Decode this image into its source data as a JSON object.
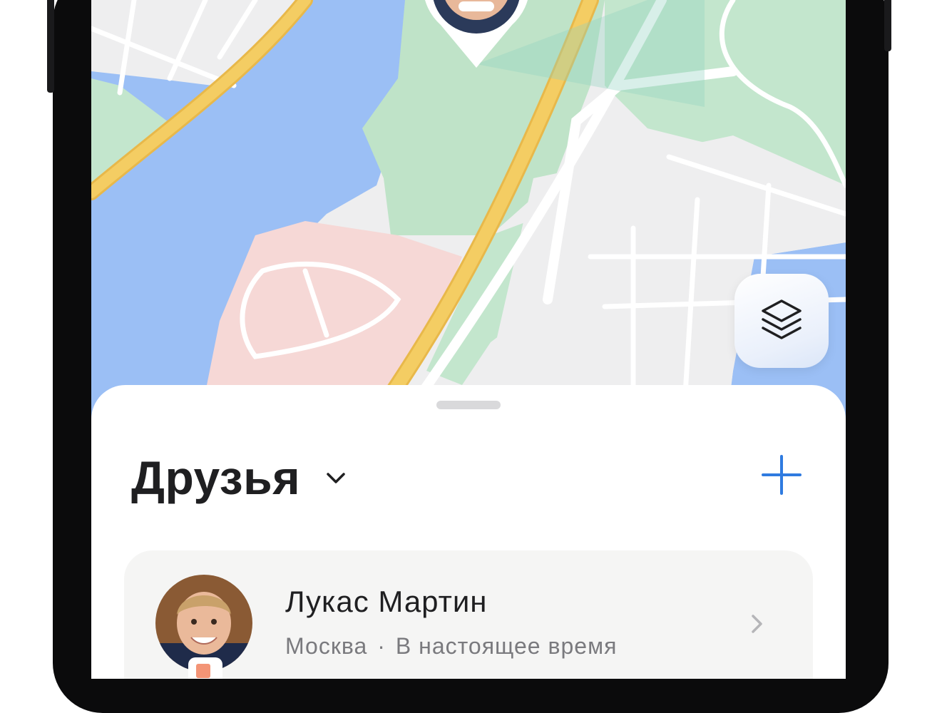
{
  "sheet": {
    "title": "Друзья",
    "add_icon": "plus-icon",
    "dropdown_icon": "chevron-down-icon"
  },
  "map": {
    "layers_icon": "layers-icon",
    "colors": {
      "water": "#9bbff5",
      "park": "#bfe3c8",
      "land": "#eeeeef",
      "road_major": "#f4cd63",
      "pink_zone": "#f6d8d6",
      "accent": "#2f7be0"
    }
  },
  "friends": [
    {
      "name": "Лукас Мартин",
      "city": "Москва",
      "separator": "·",
      "status": "В настоящее время",
      "chevron_icon": "chevron-right-icon"
    }
  ]
}
